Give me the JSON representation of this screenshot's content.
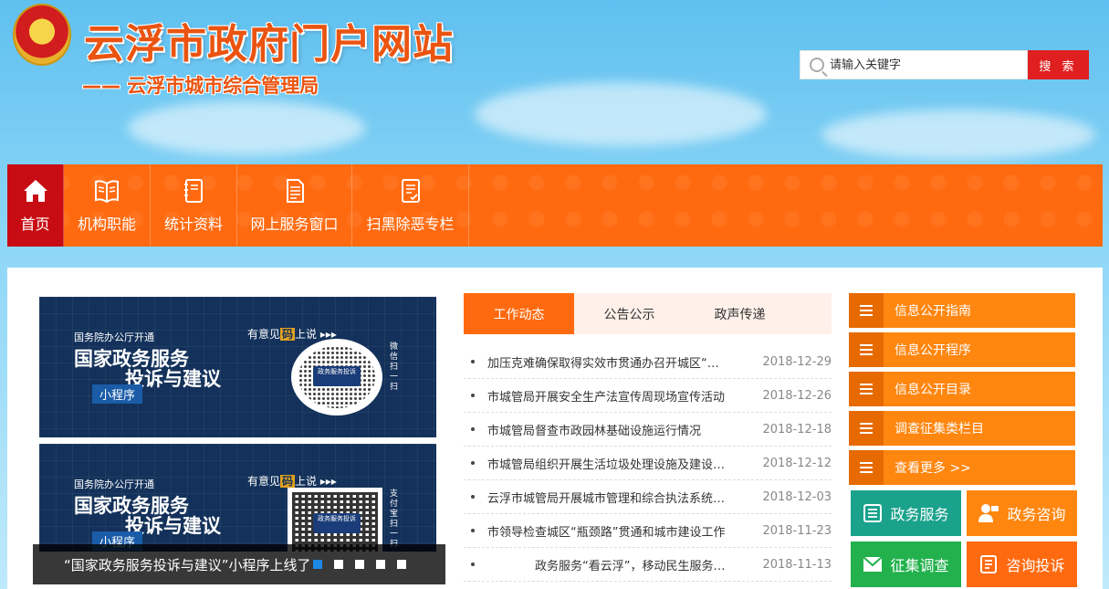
{
  "header": {
    "title": "云浮市政府门户网站",
    "subtitle": "—— 云浮市城市综合管理局",
    "search_placeholder": "请输入关键字",
    "search_button": "搜 索"
  },
  "nav": {
    "items": [
      {
        "label": "首页",
        "icon": "home-icon"
      },
      {
        "label": "机构职能",
        "icon": "book-icon"
      },
      {
        "label": "统计资料",
        "icon": "notebook-icon"
      },
      {
        "label": "网上服务窗口",
        "icon": "document-icon"
      },
      {
        "label": "扫黑除恶专栏",
        "icon": "file-icon"
      }
    ]
  },
  "banner": {
    "small": "国务院办公厅开通",
    "line1": "国家政务服务",
    "line2": "投诉与建议",
    "tag": "小程序",
    "hint_pre": "有意见",
    "hint_mark": "码",
    "hint_post": "上说 ▸▸▸",
    "side_text1": "微信扫一扫",
    "side_text2": "支付宝扫一扫",
    "qr_badge": "政务服务投诉",
    "caption": "“国家政务服务投诉与建议”小程序上线了",
    "slide_count": 5
  },
  "tabs": [
    "工作动态",
    "公告公示",
    "政声传递"
  ],
  "news": [
    {
      "title": "加压克难确保取得实效市贯通办召开城区“瓶颈路”贯通工作会议",
      "date": "2018-12-29"
    },
    {
      "title": "市城管局开展安全生产法宣传周现场宣传活动",
      "date": "2018-12-26"
    },
    {
      "title": "市城管局督查市政园林基础设施运行情况",
      "date": "2018-12-18"
    },
    {
      "title": "市城管局组织开展生活垃圾处理设施及建设情况检查",
      "date": "2018-12-12"
    },
    {
      "title": "云浮市城管局开展城市管理和综合执法系统培训",
      "date": "2018-12-03"
    },
    {
      "title": "市领导检查城区“瓶颈路”贯通和城市建设工作",
      "date": "2018-11-23"
    },
    {
      "title": "　　　　政务服务“看云浮”，移动民生服务上线",
      "date": "2018-11-13"
    }
  ],
  "quick_links": [
    "信息公开指南",
    "信息公开程序",
    "信息公开目录",
    "调查征集类栏目",
    "查看更多 >>"
  ],
  "big_buttons": [
    {
      "label": "政务服务",
      "color": "#1aa28c",
      "icon": "list-icon"
    },
    {
      "label": "政务咨询",
      "color": "#ff860f",
      "icon": "person-icon"
    },
    {
      "label": "征集调查",
      "color": "#22b14c",
      "icon": "mail-icon"
    },
    {
      "label": "咨询投诉",
      "color": "#ff6a10",
      "icon": "complaint-icon"
    }
  ],
  "colors": {
    "accent": "#ff6a10",
    "active_nav": "#c80c14",
    "search_btn": "#e02020"
  }
}
